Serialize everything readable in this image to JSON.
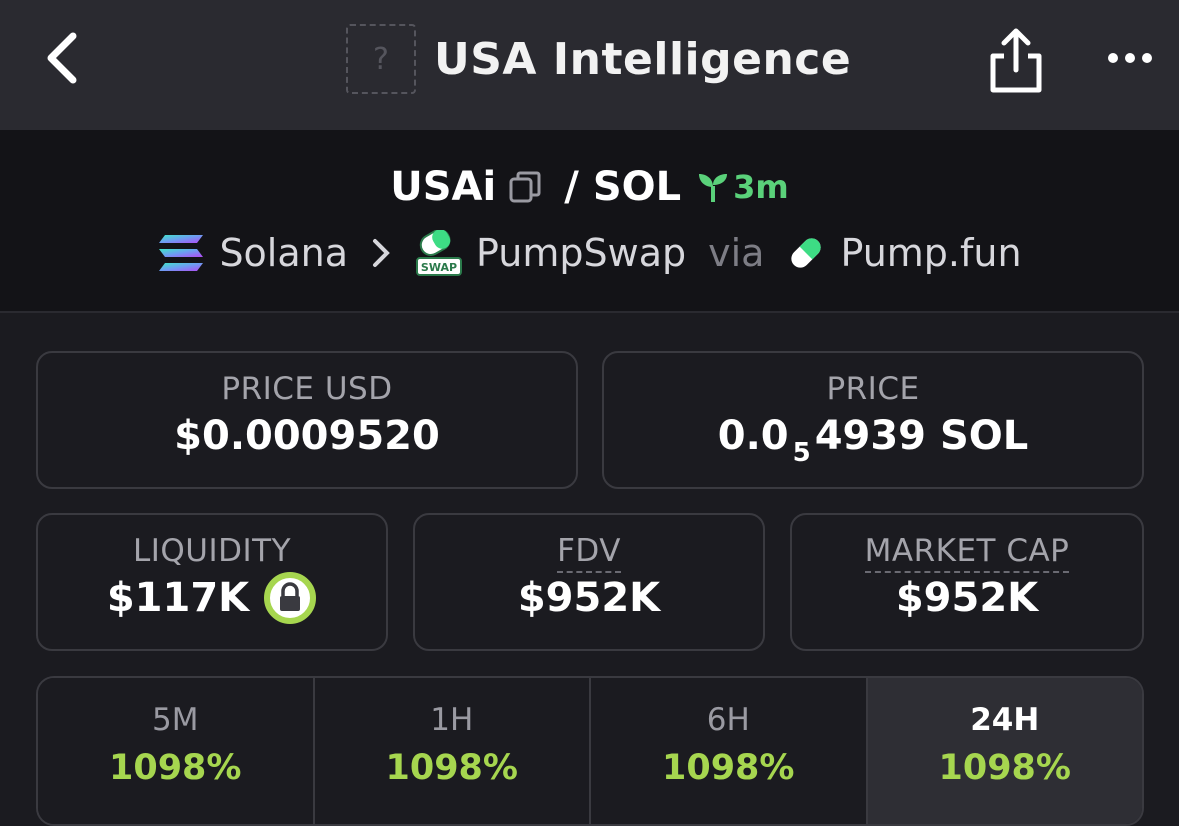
{
  "header": {
    "title": "USA Intelligence",
    "token_placeholder": "?"
  },
  "pair": {
    "base": "USAi",
    "separator": "/",
    "quote": "SOL",
    "age": "3m",
    "chain": "Solana",
    "dex": "PumpSwap",
    "via": "via",
    "launchpad": "Pump.fun",
    "swap_badge": "SWAP"
  },
  "stats": {
    "price_usd": {
      "label": "PRICE USD",
      "value": "$0.0009520"
    },
    "price": {
      "label": "PRICE",
      "prefix": "0.0",
      "subscript": "5",
      "suffix": "4939 SOL"
    },
    "liquidity": {
      "label": "LIQUIDITY",
      "value": "$117K"
    },
    "fdv": {
      "label": "FDV",
      "value": "$952K"
    },
    "market_cap": {
      "label": "MARKET CAP",
      "value": "$952K"
    }
  },
  "changes": [
    {
      "label": "5M",
      "value": "1098%"
    },
    {
      "label": "1H",
      "value": "1098%"
    },
    {
      "label": "6H",
      "value": "1098%"
    },
    {
      "label": "24H",
      "value": "1098%"
    }
  ],
  "colors": {
    "green_positive": "#a6d64f",
    "age_green": "#5ad17a",
    "background": "#1b1b20",
    "topbar": "#2a2a30"
  },
  "icons": [
    "back-chevron-icon",
    "share-icon",
    "more-icon",
    "copy-icon",
    "sprout-icon",
    "solana-icon",
    "pumpswap-icon",
    "pumpfun-icon",
    "lock-icon"
  ]
}
